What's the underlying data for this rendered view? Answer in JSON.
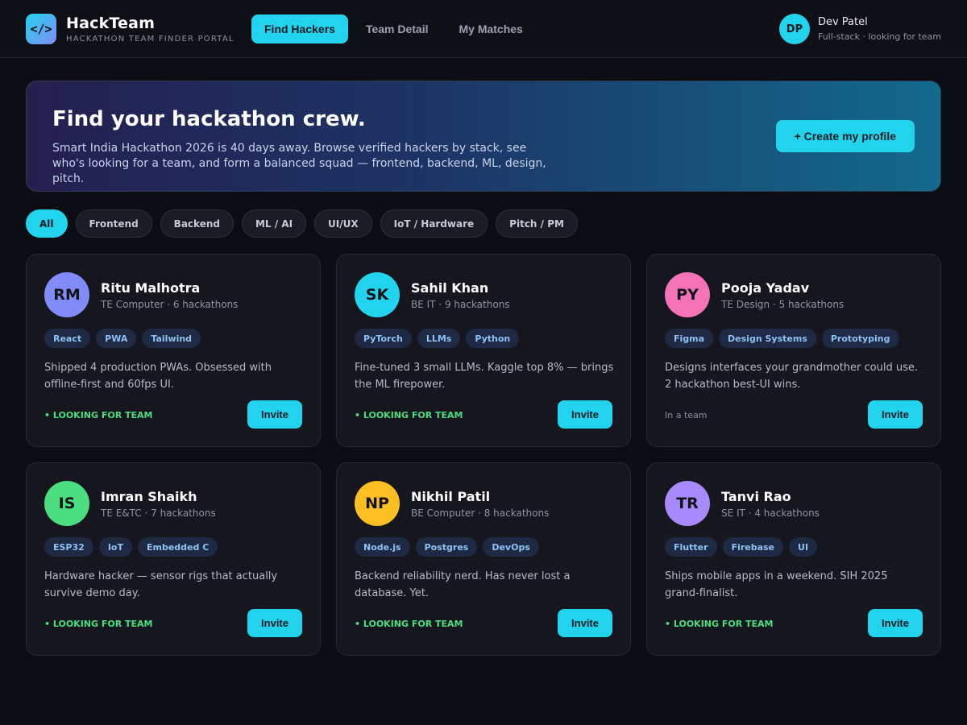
{
  "header": {
    "logo_glyph": "</>",
    "brand_name": "HackTeam",
    "brand_sub": "HACKATHON TEAM FINDER PORTAL",
    "tabs": [
      {
        "label": "Find Hackers",
        "active": true
      },
      {
        "label": "Team Detail",
        "active": false
      },
      {
        "label": "My Matches",
        "active": false
      }
    ],
    "user": {
      "initials": "DP",
      "name": "Dev Patel",
      "role": "Full-stack · looking for team"
    }
  },
  "hero": {
    "title": "Find your hackathon crew.",
    "text": "Smart India Hackathon 2026 is 40 days away. Browse verified hackers by stack, see who's looking for a team, and form a balanced squad — frontend, backend, ML, design, pitch.",
    "cta": "+ Create my profile"
  },
  "filters": [
    {
      "label": "All",
      "active": true
    },
    {
      "label": "Frontend",
      "active": false
    },
    {
      "label": "Backend",
      "active": false
    },
    {
      "label": "ML / AI",
      "active": false
    },
    {
      "label": "UI/UX",
      "active": false
    },
    {
      "label": "IoT / Hardware",
      "active": false
    },
    {
      "label": "Pitch / PM",
      "active": false
    }
  ],
  "cards": [
    {
      "initials": "RM",
      "color": "#818cf8",
      "name": "Ritu Malhotra",
      "meta": "TE Computer · 6 hackathons",
      "tags": [
        "React",
        "PWA",
        "Tailwind"
      ],
      "bio": "Shipped 4 production PWAs. Obsessed with offline-first and 60fps UI.",
      "status": "• LOOKING FOR TEAM",
      "looking": true,
      "button": "Invite"
    },
    {
      "initials": "SK",
      "color": "#22d3ee",
      "name": "Sahil Khan",
      "meta": "BE IT · 9 hackathons",
      "tags": [
        "PyTorch",
        "LLMs",
        "Python"
      ],
      "bio": "Fine-tuned 3 small LLMs. Kaggle top 8% — brings the ML firepower.",
      "status": "• LOOKING FOR TEAM",
      "looking": true,
      "button": "Invite"
    },
    {
      "initials": "PY",
      "color": "#f472b6",
      "name": "Pooja Yadav",
      "meta": "TE Design · 5 hackathons",
      "tags": [
        "Figma",
        "Design Systems",
        "Prototyping"
      ],
      "bio": "Designs interfaces your grandmother could use. 2 hackathon best-UI wins.",
      "status": "In a team",
      "looking": false,
      "button": "Invite"
    },
    {
      "initials": "IS",
      "color": "#4ade80",
      "name": "Imran Shaikh",
      "meta": "TE E&TC · 7 hackathons",
      "tags": [
        "ESP32",
        "IoT",
        "Embedded C"
      ],
      "bio": "Hardware hacker — sensor rigs that actually survive demo day.",
      "status": "• LOOKING FOR TEAM",
      "looking": true,
      "button": "Invite"
    },
    {
      "initials": "NP",
      "color": "#fbbf24",
      "name": "Nikhil Patil",
      "meta": "BE Computer · 8 hackathons",
      "tags": [
        "Node.js",
        "Postgres",
        "DevOps"
      ],
      "bio": "Backend reliability nerd. Has never lost a database. Yet.",
      "status": "• LOOKING FOR TEAM",
      "looking": true,
      "button": "Invite"
    },
    {
      "initials": "TR",
      "color": "#a78bfa",
      "name": "Tanvi Rao",
      "meta": "SE IT · 4 hackathons",
      "tags": [
        "Flutter",
        "Firebase",
        "UI"
      ],
      "bio": "Ships mobile apps in a weekend. SIH 2025 grand-finalist.",
      "status": "• LOOKING FOR TEAM",
      "looking": true,
      "button": "Invite"
    }
  ]
}
